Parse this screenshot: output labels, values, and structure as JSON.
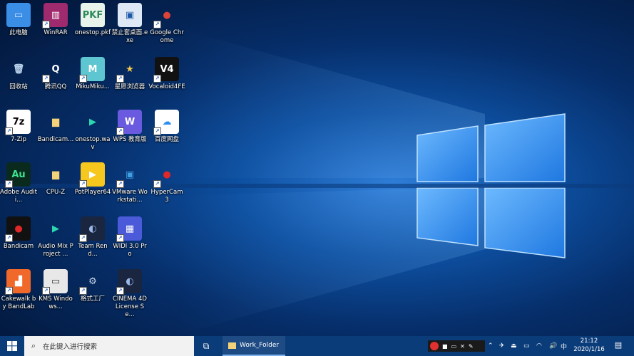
{
  "desktop": {
    "icons": [
      {
        "label": "此电脑",
        "name": "this-pc-icon",
        "glyph": "▭",
        "bg": "#3a8ee6",
        "fg": "#cfe6ff",
        "sc": false
      },
      {
        "label": "WinRAR",
        "name": "winrar-icon",
        "glyph": "▥",
        "bg": "#a02a6e",
        "fg": "#fff",
        "sc": true
      },
      {
        "label": "onestop.pkf",
        "name": "pkf-file-icon",
        "glyph": "PKF",
        "bg": "#e8f3ec",
        "fg": "#2c8a5a",
        "sc": false
      },
      {
        "label": "禁止套桌面.exe",
        "name": "exe-file-icon",
        "glyph": "▣",
        "bg": "#dfe8f5",
        "fg": "#1e5aa8",
        "sc": false
      },
      {
        "label": "Google Chrome",
        "name": "chrome-icon",
        "glyph": "●",
        "bg": "transparent",
        "fg": "#db4437",
        "sc": true
      },
      {
        "label": "回收站",
        "name": "recycle-bin-icon",
        "glyph": "🗑",
        "bg": "transparent",
        "fg": "#bcd4ee",
        "sc": false
      },
      {
        "label": "腾讯QQ",
        "name": "qq-icon",
        "glyph": "Q",
        "bg": "transparent",
        "fg": "#fff",
        "sc": true
      },
      {
        "label": "MikuMiku...",
        "name": "mikumiku-icon",
        "glyph": "M",
        "bg": "#5ec6d0",
        "fg": "#fff",
        "sc": true
      },
      {
        "label": "星愿浏览器",
        "name": "star-browser-icon",
        "glyph": "★",
        "bg": "transparent",
        "fg": "#f2c84b",
        "sc": true
      },
      {
        "label": "Vocaloid4FE",
        "name": "vocaloid-icon",
        "glyph": "V4",
        "bg": "#111",
        "fg": "#fff",
        "sc": true
      },
      {
        "label": "7-Zip",
        "name": "7zip-icon",
        "glyph": "7z",
        "bg": "#fff",
        "fg": "#000",
        "sc": true
      },
      {
        "label": "Bandicam...",
        "name": "folder-icon",
        "glyph": "▆",
        "bg": "transparent",
        "fg": "#f3d27a",
        "sc": false
      },
      {
        "label": "onestop.wav",
        "name": "wav-file-icon",
        "glyph": "▶",
        "bg": "transparent",
        "fg": "#2bd6b0",
        "sc": false
      },
      {
        "label": "WPS 教育版",
        "name": "wps-icon",
        "glyph": "W",
        "bg": "#6a5ae0",
        "fg": "#fff",
        "sc": true
      },
      {
        "label": "百度网盘",
        "name": "baidu-netdisk-icon",
        "glyph": "☁",
        "bg": "#fff",
        "fg": "#2a8ef0",
        "sc": true
      },
      {
        "label": "Adobe Auditi...",
        "name": "audition-icon",
        "glyph": "Au",
        "bg": "#0a2a1e",
        "fg": "#3ee08e",
        "sc": true
      },
      {
        "label": "CPU-Z",
        "name": "folder-icon",
        "glyph": "▆",
        "bg": "transparent",
        "fg": "#f3d27a",
        "sc": false
      },
      {
        "label": "PotPlayer64",
        "name": "potplayer-icon",
        "glyph": "▶",
        "bg": "#f6c81e",
        "fg": "#fff",
        "sc": true
      },
      {
        "label": "VMware Workstati...",
        "name": "vmware-icon",
        "glyph": "▣",
        "bg": "transparent",
        "fg": "#3ea0e0",
        "sc": true
      },
      {
        "label": "HyperCam 3",
        "name": "hypercam-icon",
        "glyph": "●",
        "bg": "transparent",
        "fg": "#e02828",
        "sc": true
      },
      {
        "label": "Bandicam",
        "name": "bandicam-icon",
        "glyph": "●",
        "bg": "#111",
        "fg": "#e02828",
        "sc": true
      },
      {
        "label": "Audio Mix Project ...",
        "name": "mp3-file-icon",
        "glyph": "▶",
        "bg": "transparent",
        "fg": "#2bd6b0",
        "sc": false
      },
      {
        "label": "Team Rend...",
        "name": "team-render-icon",
        "glyph": "◐",
        "bg": "#1a2540",
        "fg": "#9ab8e8",
        "sc": true
      },
      {
        "label": "WIDI 3.0 Pro",
        "name": "widi-icon",
        "glyph": "▦",
        "bg": "#4a5ad8",
        "fg": "#fff",
        "sc": true
      },
      {
        "label": "",
        "name": "blank",
        "glyph": "",
        "bg": "transparent",
        "fg": "#fff",
        "sc": false
      },
      {
        "label": "Cakewalk by BandLab",
        "name": "cakewalk-icon",
        "glyph": "▟",
        "bg": "#f0682a",
        "fg": "#fff",
        "sc": true
      },
      {
        "label": "KMS Windows...",
        "name": "kms-icon",
        "glyph": "▭",
        "bg": "#e8e8e8",
        "fg": "#333",
        "sc": true
      },
      {
        "label": "格式工厂",
        "name": "format-factory-icon",
        "glyph": "⚙",
        "bg": "transparent",
        "fg": "#c8d8e8",
        "sc": true
      },
      {
        "label": "CINEMA 4D License Se...",
        "name": "cinema4d-icon",
        "glyph": "◐",
        "bg": "#1a2540",
        "fg": "#9ab8e8",
        "sc": true
      }
    ]
  },
  "taskbar": {
    "search_placeholder": "在此键入进行搜索",
    "app_label": "Work_Folder",
    "clock_time": "21:12",
    "clock_date": "2020/1/16",
    "ime_label": "中"
  }
}
